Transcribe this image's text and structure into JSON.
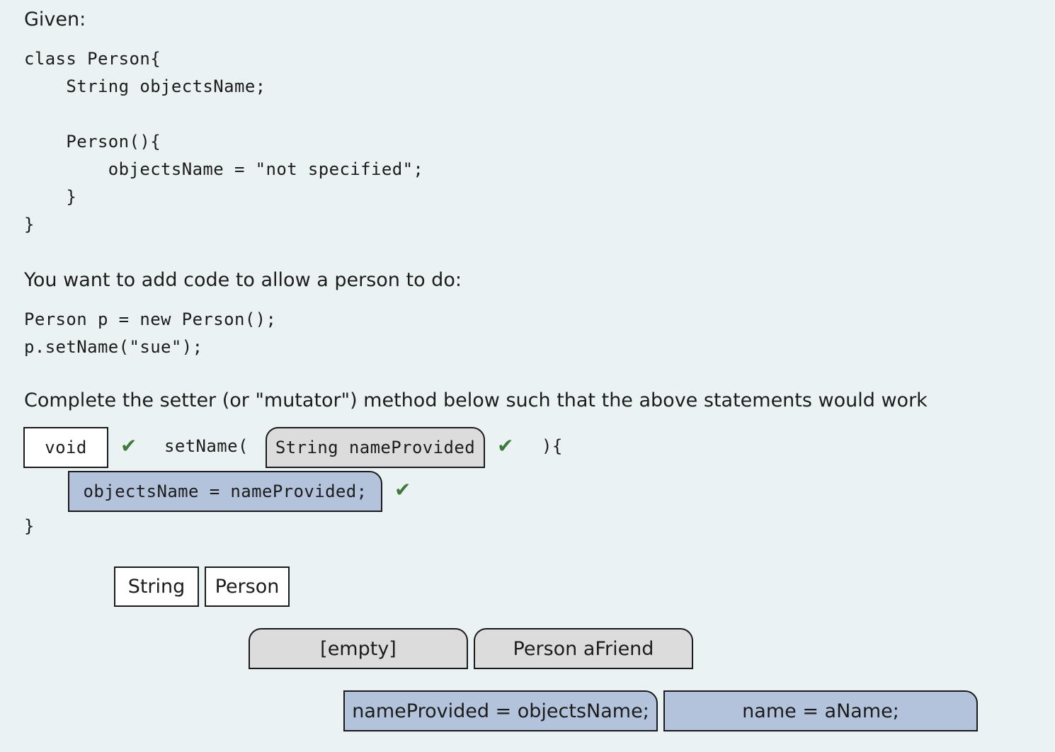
{
  "intro": {
    "given_label": "Given:",
    "class_code": "class Person{\n    String objectsName;\n\n    Person(){\n        objectsName = \"not specified\";\n    }\n}",
    "want_label": "You want to add code to allow a person to do:",
    "usage_code": "Person p = new Person();\np.setName(\"sue\");",
    "instruction": "Complete the setter (or \"mutator\") method below such that the above statements would work"
  },
  "method": {
    "return_type_slot": "void",
    "name_text": "setName(",
    "param_slot": "String nameProvided",
    "close_paren_text": "){",
    "body_slot": "objectsName = nameProvided;",
    "closing_brace": "}",
    "check_glyph": "✔"
  },
  "choices": {
    "types": [
      "String",
      "Person"
    ],
    "params": [
      "[empty]",
      "Person aFriend"
    ],
    "statements": [
      "nameProvided = objectsName;",
      "name = aName;"
    ]
  },
  "colors": {
    "background": "#eaf2f4",
    "check": "#3e7b3a",
    "type_tile": "#ffffff",
    "param_tile": "#dcdcdc",
    "statement_tile": "#b4c3dc"
  }
}
